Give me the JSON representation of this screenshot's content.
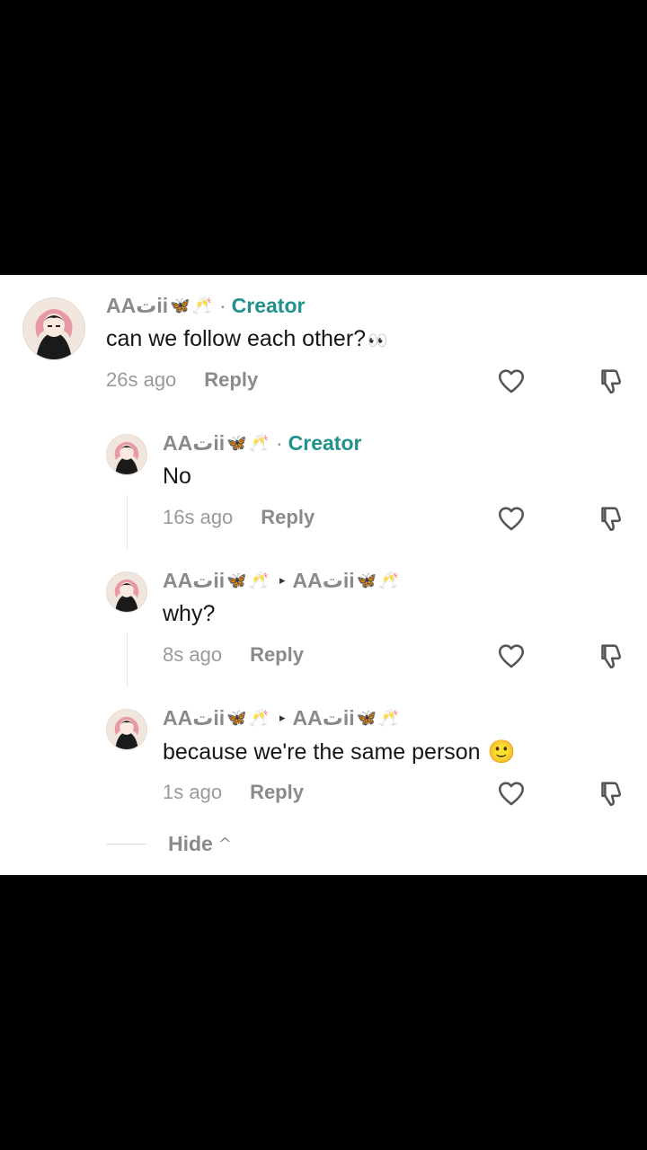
{
  "panel_background": "#ffffff",
  "accent_color": "#21918c",
  "comments": [
    {
      "username": "AAتii",
      "emoji_a": "🦋",
      "emoji_b": "🥂",
      "dot": "·",
      "badge": "Creator",
      "text": "can we follow each other?",
      "text_emoji": "👀",
      "time": "26s ago",
      "reply": "Reply",
      "like_icon": "heart-icon",
      "dislike_icon": "thumbs-down-icon"
    },
    {
      "username": "AAتii",
      "emoji_a": "🦋",
      "emoji_b": "🥂",
      "dot": "·",
      "badge": "Creator",
      "text": "No",
      "time": "16s ago",
      "reply": "Reply"
    },
    {
      "username": "AAتii",
      "emoji_a": "🦋",
      "emoji_b": "🥂",
      "reply_to_arrow": "▸",
      "reply_to_username": "AAتii",
      "text": "why?",
      "time": "8s ago",
      "reply": "Reply"
    },
    {
      "username": "AAتii",
      "emoji_a": "🦋",
      "emoji_b": "🥂",
      "reply_to_arrow": "▸",
      "reply_to_username": "AAتii",
      "text": "because we're the same person",
      "text_emoji": "🙂",
      "time": "1s ago",
      "reply": "Reply"
    }
  ],
  "hide": {
    "label": "Hide",
    "caret": "^"
  }
}
